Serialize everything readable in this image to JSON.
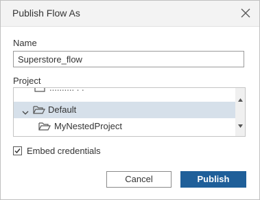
{
  "dialog": {
    "title": "Publish Flow As",
    "close_icon": "close-icon"
  },
  "name_field": {
    "label": "Name",
    "value": "Superstore_flow"
  },
  "project": {
    "label": "Project",
    "items": [
      {
        "label": "Default",
        "expanded": true,
        "selected": true,
        "icon": "folder-open-icon"
      },
      {
        "label": "MyNestedProject",
        "expanded": false,
        "selected": false,
        "icon": "folder-open-icon"
      }
    ]
  },
  "embed": {
    "label": "Embed credentials",
    "checked": true
  },
  "buttons": {
    "cancel": "Cancel",
    "publish": "Publish"
  },
  "colors": {
    "titlebar_bg": "#f3f3f3",
    "selected_row_bg": "#d6e0ea",
    "primary_button": "#1f5f99"
  }
}
